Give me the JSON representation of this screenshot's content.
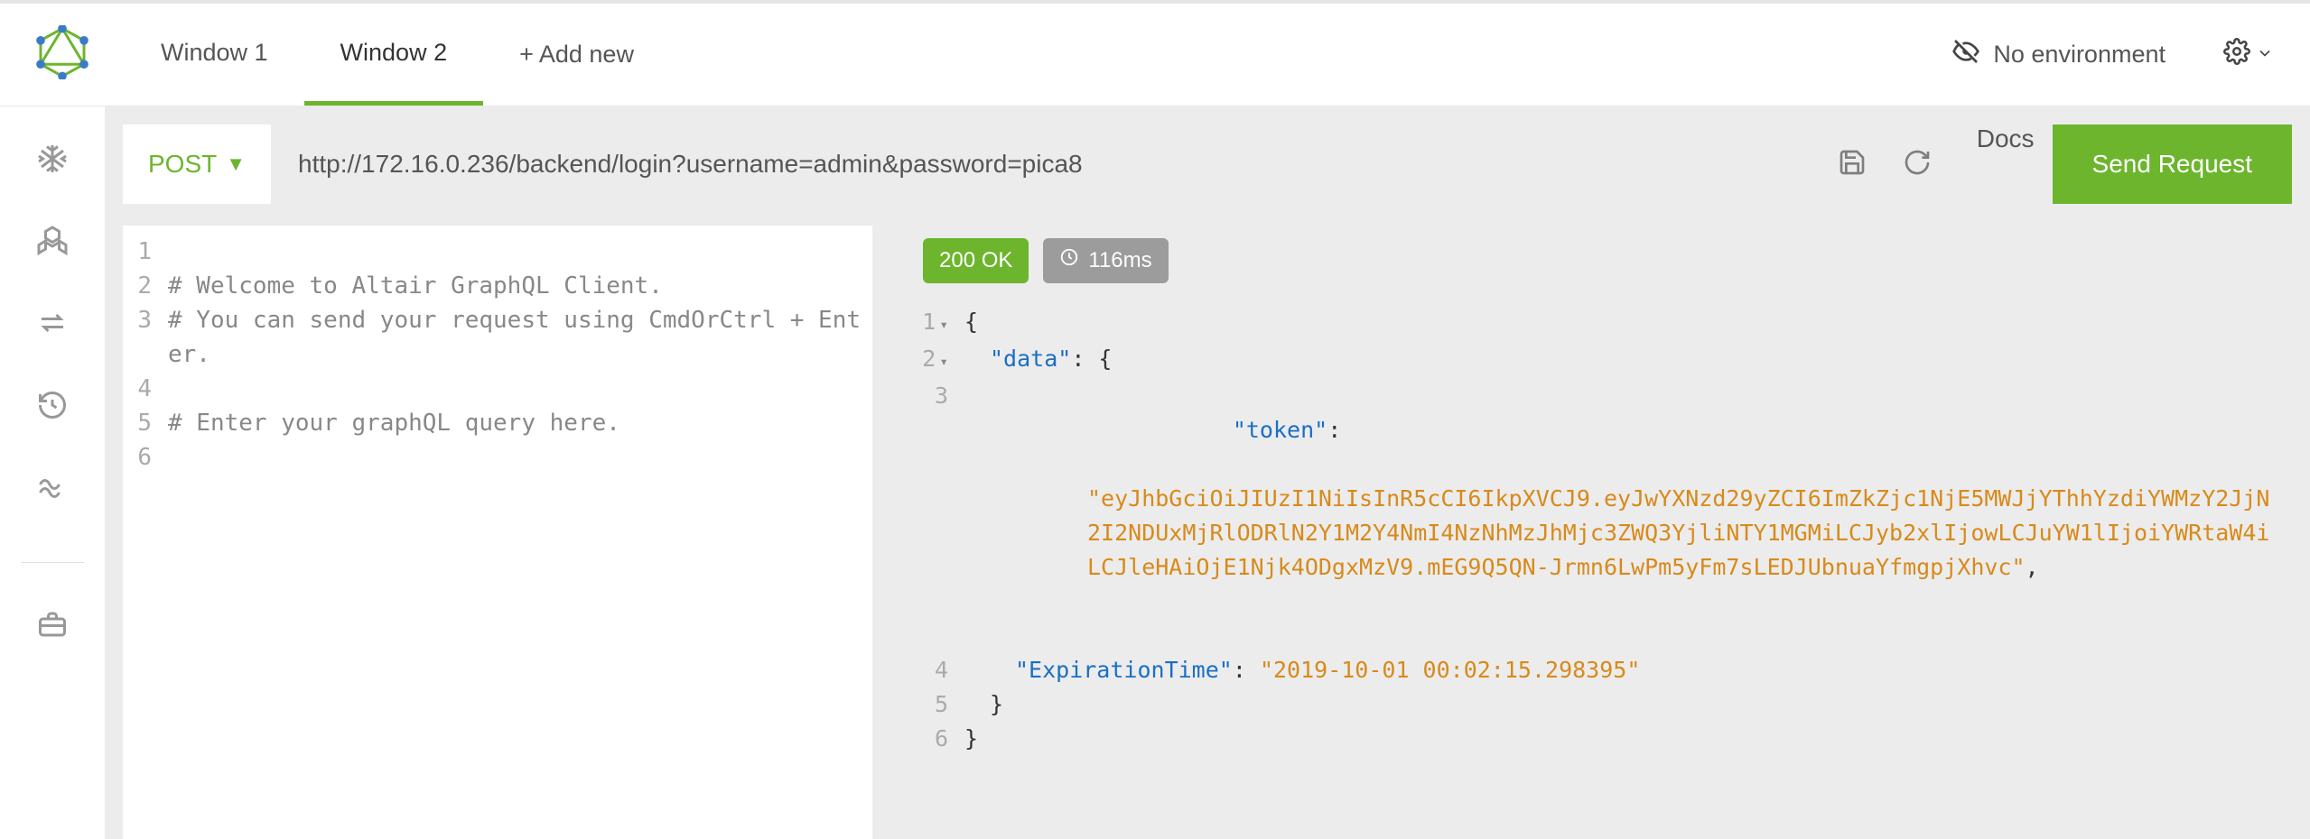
{
  "topbar": {
    "tabs": [
      {
        "label": "Window 1",
        "active": false
      },
      {
        "label": "Window 2",
        "active": true
      }
    ],
    "add_label": "+ Add new",
    "environment_label": "No environment"
  },
  "urlbar": {
    "method": "POST",
    "url": "http://172.16.0.236/backend/login?username=admin&password=pica8",
    "docs_label": "Docs",
    "send_label": "Send Request"
  },
  "editor": {
    "lines": [
      {
        "num": "1",
        "text": "",
        "type": "blank"
      },
      {
        "num": "2",
        "text": "# Welcome to Altair GraphQL Client.",
        "type": "comment"
      },
      {
        "num": "3",
        "text": "# You can send your request using CmdOrCtrl + Enter.",
        "type": "comment"
      },
      {
        "num": "4",
        "text": "",
        "type": "blank"
      },
      {
        "num": "5",
        "text": "# Enter your graphQL query here.",
        "type": "comment"
      },
      {
        "num": "6",
        "text": "",
        "type": "blank"
      }
    ]
  },
  "result": {
    "status": "200 OK",
    "time": "116ms",
    "json": {
      "data_key": "\"data\"",
      "token_key": "\"token\"",
      "token_value": "\"eyJhbGciOiJIUzI1NiIsInR5cCI6IkpXVCJ9.eyJwYXNzd29yZCI6ImZkZjc1NjE5MWJjYThhYzdiYWMzY2JjN2I2NDUxMjRlODRlN2Y1M2Y4NmI4NzNhMzJhMjc3ZWQ3YjliNTY1MGMiLCJyb2xlIjowLCJuYW1lIjoiYWRtaW4iLCJleHAiOjE1Njk4ODgxMzV9.mEG9Q5QN-Jrmn6LwPm5yFm7sLEDJUbnuaYfmgpjXhvc\"",
      "exp_key": "\"ExpirationTime\"",
      "exp_value": "\"2019-10-01 00:02:15.298395\""
    },
    "line_nums": [
      "1",
      "2",
      "3",
      "4",
      "5",
      "6"
    ]
  }
}
